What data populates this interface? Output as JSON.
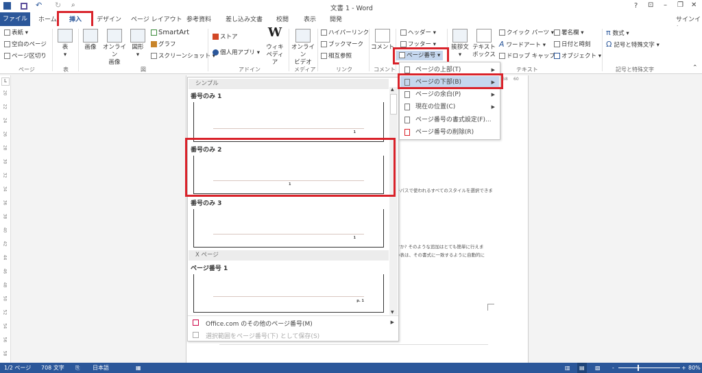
{
  "title": "文書 1 - Word",
  "window_controls": {
    "help": "?",
    "ribbon_options": "⊡",
    "minimize": "–",
    "restore": "❐",
    "close": "✕"
  },
  "signin": "サインイン",
  "tabs": [
    "ファイル",
    "ホーム",
    "挿入",
    "デザイン",
    "ページ レイアウト",
    "参考資料",
    "差し込み文書",
    "校閲",
    "表示",
    "開発"
  ],
  "active_tab": "挿入",
  "ribbon": {
    "page": {
      "items": [
        "表紙",
        "空白のページ",
        "ページ区切り"
      ],
      "label": "ページ"
    },
    "table": {
      "button": "表",
      "label": "表"
    },
    "illustrations": {
      "image": "画像",
      "online_image": "オンライン\n画像",
      "shapes": "図形",
      "smartart": "SmartArt",
      "chart": "グラフ",
      "screenshot": "スクリーンショット",
      "label": "図"
    },
    "addins": {
      "store": "ストア",
      "my_apps": "個人用アプリ",
      "wikipedia": "ウィキ\nペディア",
      "label": "アドイン"
    },
    "media": {
      "online_video": "オンライン\nビデオ",
      "label": "メディア"
    },
    "links": {
      "items": [
        "ハイパーリンク",
        "ブックマーク",
        "相互参照"
      ],
      "label": "リンク"
    },
    "comments": {
      "button": "コメント",
      "label": "コメント"
    },
    "header_footer": {
      "header": "ヘッダー",
      "footer": "フッター",
      "page_number": "ページ番号"
    },
    "text": {
      "greeting": "挨拶文",
      "textbox": "テキスト\nボックス",
      "quick_parts": "クイック パーツ",
      "wordart": "ワードアート",
      "dropcap": "ドロップ キャップ",
      "signature": "署名欄",
      "datetime": "日付と時刻",
      "object": "オブジェクト",
      "label": "テキスト"
    },
    "symbols": {
      "equation": "数式",
      "symbol": "記号と特殊文字",
      "label": "記号と特殊文字"
    }
  },
  "submenu": [
    {
      "label": "ページの上部(T)",
      "arrow": true
    },
    {
      "label": "ページの下部(B)",
      "arrow": true,
      "highlighted": true
    },
    {
      "label": "ページの余白(P)",
      "arrow": true
    },
    {
      "label": "現在の位置(C)",
      "arrow": true
    },
    {
      "label": "ページ番号の書式設定(F)...",
      "arrow": false
    },
    {
      "label": "ページ番号の削除(R)",
      "arrow": false
    }
  ],
  "gallery": {
    "section1": "シンプル",
    "items": [
      {
        "title": "番号のみ 1",
        "num": "1"
      },
      {
        "title": "番号のみ 2",
        "num": "1"
      },
      {
        "title": "番号のみ 3",
        "num": "1"
      }
    ],
    "section2": "X ページ",
    "item4": {
      "title": "ページ番号 1",
      "num": "p. 1"
    },
    "more": "Office.com のその他のページ番号(M)",
    "save": "選択範囲をページ番号(下) として保存(S)"
  },
  "ruler": {
    "h": [
      "58",
      "60"
    ],
    "v": [
      "20",
      "22",
      "24",
      "26",
      "28",
      "30",
      "32",
      "34",
      "36",
      "38",
      "40",
      "42",
      "44",
      "46",
      "48",
      "50",
      "52",
      "54",
      "56",
      "58",
      "60"
    ]
  },
  "doc_text": [
    "ラパスで使われるすべてのスタイルを選択できま",
    "すか? そのような追加はとても簡単に行えま",
    "い表は、その書式に一致するように自動的に"
  ],
  "status": {
    "page": "1/2 ページ",
    "words": "708 文字",
    "lang": "日本語",
    "zoom": "80%"
  },
  "colors": {
    "accent": "#2b579a",
    "highlight": "#d9222a"
  }
}
